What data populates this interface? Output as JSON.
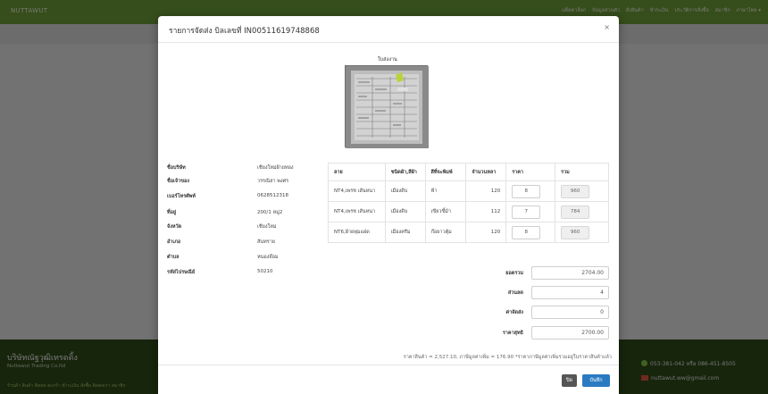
{
  "navbar": {
    "brand": "NUTTAWUT",
    "links": [
      "แค็ตตาล็อก",
      "ข้อมูลส่วนตัว",
      "สั่งสินค้า",
      "ชำระเงิน",
      "ประวัติการสั่งซื้อ",
      "สมาชิก",
      "ภาษาไทย ▾"
    ]
  },
  "footer": {
    "company_th": "บริษัทณัฐวุฒิเทรดดิ้ง",
    "company_en": "Nuttawut Trading Co.ltd",
    "links": "ร้านค้า  สินค้า  ติดต่อ  ตะกร้า  ชำระเงิน  สั่งซื้อ  ติดต่อเรา  สมาชิก",
    "phone": "053-381-042 หรือ 086-451-8505",
    "email": "nuttawut.ww@gmail.com"
  },
  "modal": {
    "title": "รายการจัดส่ง บิลเลขที่ IN00511619748868",
    "close_symbol": "×",
    "image_label": "ใบส่งงาน",
    "customer": [
      {
        "label": "ชื่อบริษัท",
        "value": "เชียงใหม่ฝ้ายทอง"
      },
      {
        "label": "ชื่อเจ้าของ",
        "value": "วรรณิสา พงศร"
      },
      {
        "label": "เบอร์โทรศัพท์",
        "value": "0628512318"
      },
      {
        "label": "ที่อยู่",
        "value": "200/1 หมู่2"
      },
      {
        "label": "จังหวัด",
        "value": "เชียงใหม่"
      },
      {
        "label": "อำเภอ",
        "value": "สันทราย"
      },
      {
        "label": "ตำบล",
        "value": "หนองจ๊อม"
      },
      {
        "label": "รหัสไปรษณีย์",
        "value": "50210"
      }
    ],
    "table": {
      "headers": [
        "ลาย",
        "ชนิดผ้า,สีผ้า",
        "สีที่จะพิมพ์",
        "จำนวนหลา",
        "ราคา",
        "รวม"
      ],
      "rows": [
        {
          "pattern": "NT4,เพรช เส้นหนา",
          "fabric": "เมืองดิบ",
          "print_color": "ฟ้า",
          "yards": "120",
          "price": "8",
          "total": "960"
        },
        {
          "pattern": "NT4,เพรช เส้นหนา",
          "fabric": "เมืองดิบ",
          "print_color": "เขียวขี้ม้า",
          "yards": "112",
          "price": "7",
          "total": "784"
        },
        {
          "pattern": "NT6,ฝ้ายพุ่มแฝด",
          "fabric": "เมืองครีม",
          "print_color": "ก๊อยาวตุ้ม",
          "yards": "120",
          "price": "8",
          "total": "960"
        }
      ]
    },
    "summary": {
      "subtotal_label": "ยอดรวม",
      "subtotal": "2704.00",
      "discount_label": "ส่วนลด",
      "discount": "4",
      "shipping_label": "ค่าจัดส่ง",
      "shipping": "0",
      "net_label": "ราคาสุทธิ",
      "net": "2700.00"
    },
    "note": "ราคาสินค้า = 2,527.10, ภาษีมูลค่าเพิ่ม = 176.90   *ราคาภาษีมูลค่าเพิ่มรวมอยู่ในราคาสินค้าแล้ว",
    "buttons": {
      "close": "ปิด",
      "save": "บันทึก"
    }
  }
}
